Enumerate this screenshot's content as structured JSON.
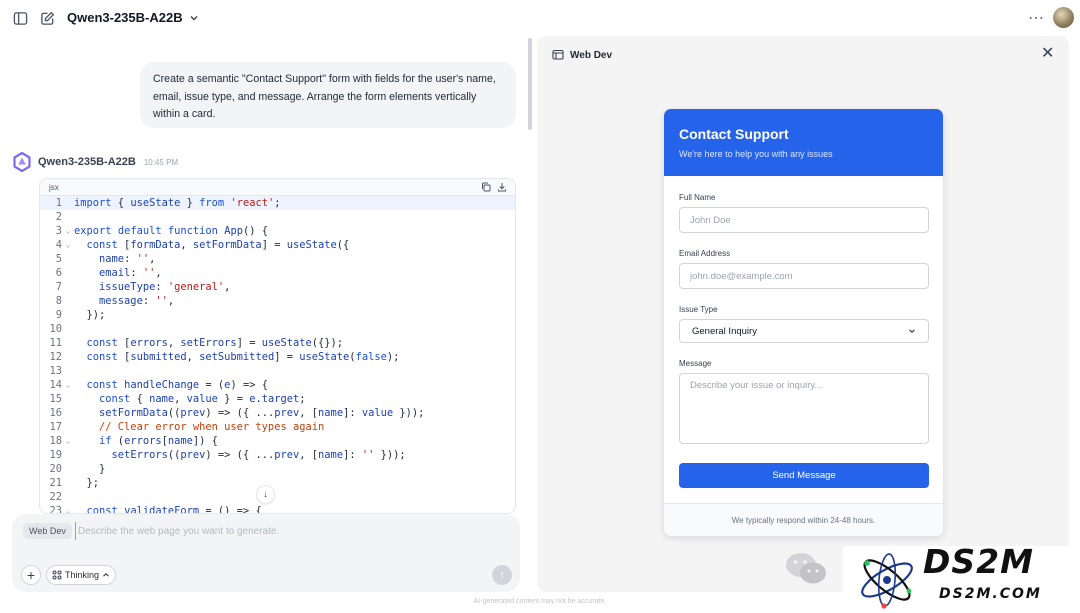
{
  "header": {
    "model_name": "Qwen3-235B-A22B"
  },
  "user_message": "Create a semantic \"Contact Support\" form with fields for the user's name, email, issue type, and message. Arrange the form elements vertically within a card.",
  "assistant": {
    "name": "Qwen3-235B-A22B",
    "time": "10:45 PM"
  },
  "code_block": {
    "language": "jsx",
    "lines": [
      {
        "n": "1",
        "fold": false,
        "text": "import { useState } from 'react';"
      },
      {
        "n": "2",
        "fold": false,
        "text": ""
      },
      {
        "n": "3",
        "fold": true,
        "text": "export default function App() {"
      },
      {
        "n": "4",
        "fold": true,
        "text": "  const [formData, setFormData] = useState({"
      },
      {
        "n": "5",
        "fold": false,
        "text": "    name: '',"
      },
      {
        "n": "6",
        "fold": false,
        "text": "    email: '',"
      },
      {
        "n": "7",
        "fold": false,
        "text": "    issueType: 'general',"
      },
      {
        "n": "8",
        "fold": false,
        "text": "    message: '',"
      },
      {
        "n": "9",
        "fold": false,
        "text": "  });"
      },
      {
        "n": "10",
        "fold": false,
        "text": ""
      },
      {
        "n": "11",
        "fold": false,
        "text": "  const [errors, setErrors] = useState({});"
      },
      {
        "n": "12",
        "fold": false,
        "text": "  const [submitted, setSubmitted] = useState(false);"
      },
      {
        "n": "13",
        "fold": false,
        "text": ""
      },
      {
        "n": "14",
        "fold": true,
        "text": "  const handleChange = (e) => {"
      },
      {
        "n": "15",
        "fold": false,
        "text": "    const { name, value } = e.target;"
      },
      {
        "n": "16",
        "fold": false,
        "text": "    setFormData((prev) => ({ ...prev, [name]: value }));"
      },
      {
        "n": "17",
        "fold": false,
        "text": "    // Clear error when user types again"
      },
      {
        "n": "18",
        "fold": true,
        "text": "    if (errors[name]) {"
      },
      {
        "n": "19",
        "fold": false,
        "text": "      setErrors((prev) => ({ ...prev, [name]: '' }));"
      },
      {
        "n": "20",
        "fold": false,
        "text": "    }"
      },
      {
        "n": "21",
        "fold": false,
        "text": "  };"
      },
      {
        "n": "22",
        "fold": false,
        "text": ""
      },
      {
        "n": "23",
        "fold": true,
        "text": "  const validateForm = () => {"
      }
    ]
  },
  "composer": {
    "mode_chip": "Web Dev",
    "placeholder": "Describe the web page you want to generate.",
    "thinking_label": "Thinking"
  },
  "disclaimer": "AI-generated content may not be accurate.",
  "preview": {
    "title": "Web Dev",
    "form": {
      "title": "Contact Support",
      "subtitle": "We're here to help you with any issues",
      "name_label": "Full Name",
      "name_placeholder": "John Doe",
      "email_label": "Email Address",
      "email_placeholder": "john.doe@example.com",
      "issue_label": "Issue Type",
      "issue_selected": "General Inquiry",
      "message_label": "Message",
      "message_placeholder": "Describe your issue or inquiry...",
      "submit_label": "Send Message",
      "footer": "We typically respond within 24-48 hours."
    }
  },
  "watermark": {
    "brand": "DS2M",
    "domain": "DS2M.COM"
  },
  "colors": {
    "accent": "#2563eb",
    "keyword": "#1d4ed8",
    "string": "#b91c1c",
    "comment": "#c2410c"
  }
}
